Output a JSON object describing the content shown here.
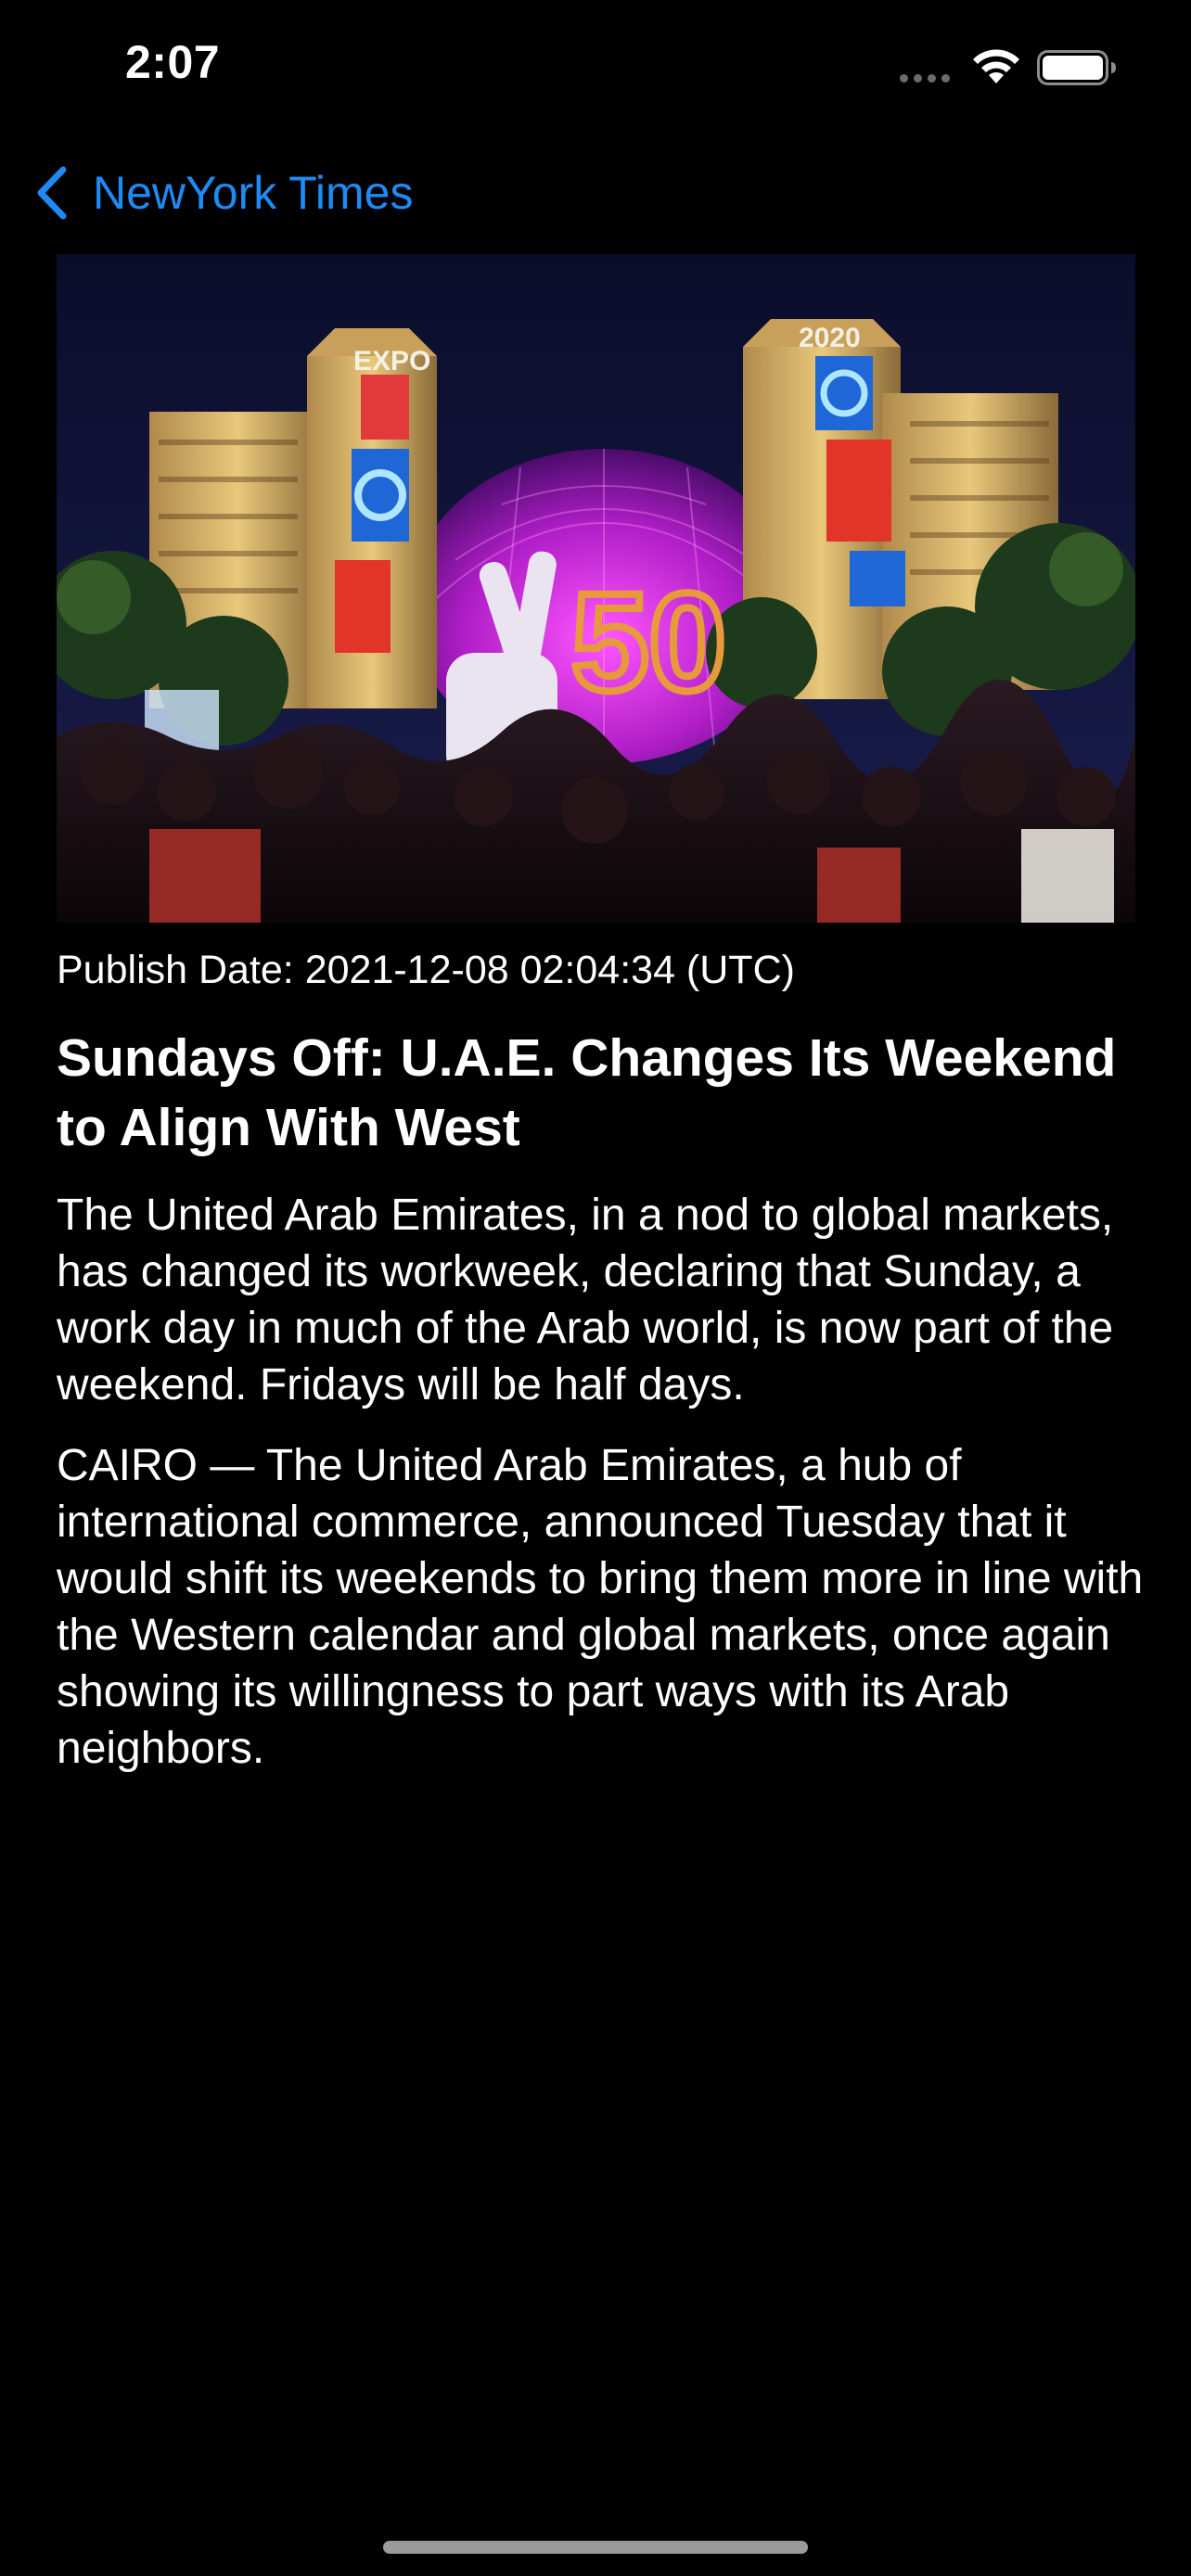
{
  "status_bar": {
    "time": "2:07",
    "signal_icon": "cellular-dots-icon",
    "wifi_icon": "wifi-icon",
    "battery_icon": "battery-icon"
  },
  "nav": {
    "back_icon": "chevron-left-icon",
    "back_label": "NewYork Times",
    "accent_color": "#1e8bf5"
  },
  "article": {
    "image_alt_icon": "article-photo",
    "image_signs": [
      "EXPO",
      "2020",
      "50"
    ],
    "publish_date": "Publish Date: 2021-12-08 02:04:34 (UTC)",
    "headline": "Sundays Off: U.A.E. Changes Its Weekend to Align With West",
    "abstract": "The United Arab Emirates, in a nod to global markets, has changed its workweek, declaring that Sunday, a work day in much of the Arab world, is now part of the weekend. Fridays will be half days.",
    "lead_paragraph": "CAIRO — The United Arab Emirates, a hub of international commerce, announced Tuesday that it would shift its weekends to bring them more in line with the Western calendar and global markets, once again showing its willingness to part ways with its Arab neighbors."
  },
  "colors": {
    "background": "#000000",
    "text": "#ffffff"
  }
}
